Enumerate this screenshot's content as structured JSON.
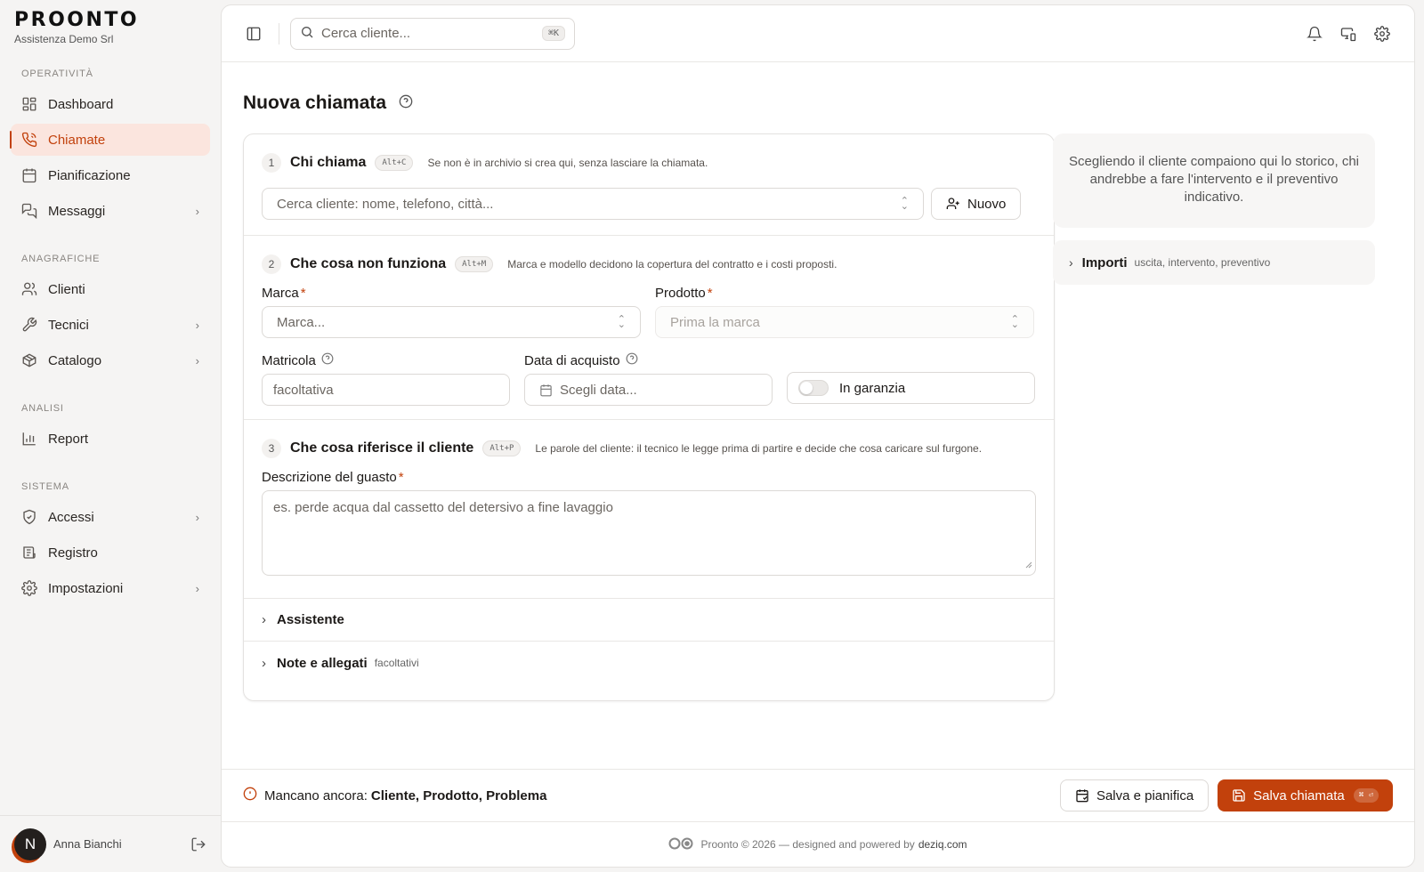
{
  "brand": {
    "logo": "PROONTO",
    "company": "Assistenza Demo Srl"
  },
  "sidebar": {
    "sections": [
      {
        "title": "OPERATIVITÀ",
        "items": [
          {
            "label": "Dashboard",
            "icon": "dashboard-icon"
          },
          {
            "label": "Chiamate",
            "icon": "phone-icon",
            "active": true
          },
          {
            "label": "Pianificazione",
            "icon": "calendar-icon"
          },
          {
            "label": "Messaggi",
            "icon": "messages-icon",
            "expandable": true
          }
        ]
      },
      {
        "title": "ANAGRAFICHE",
        "items": [
          {
            "label": "Clienti",
            "icon": "users-icon"
          },
          {
            "label": "Tecnici",
            "icon": "wrench-icon",
            "expandable": true
          },
          {
            "label": "Catalogo",
            "icon": "package-icon",
            "expandable": true
          }
        ]
      },
      {
        "title": "ANALISI",
        "items": [
          {
            "label": "Report",
            "icon": "bar-chart-icon"
          }
        ]
      },
      {
        "title": "SISTEMA",
        "items": [
          {
            "label": "Accessi",
            "icon": "shield-icon",
            "expandable": true
          },
          {
            "label": "Registro",
            "icon": "log-icon"
          },
          {
            "label": "Impostazioni",
            "icon": "gear-icon",
            "expandable": true
          }
        ]
      }
    ],
    "user": {
      "initial": "N",
      "name": "Anna Bianchi"
    }
  },
  "topbar": {
    "search_placeholder": "Cerca cliente...",
    "search_kbd": "⌘K"
  },
  "page": {
    "title": "Nuova chiamata"
  },
  "form": {
    "section1": {
      "step": "1",
      "title": "Chi chiama",
      "kbd": "Alt+C",
      "hint": "Se non è in archivio si crea qui, senza lasciare la chiamata.",
      "client_placeholder": "Cerca cliente: nome, telefono, città...",
      "new_button": "Nuovo"
    },
    "section2": {
      "step": "2",
      "title": "Che cosa non funziona",
      "kbd": "Alt+M",
      "hint": "Marca e modello decidono la copertura del contratto e i costi proposti.",
      "marca_label": "Marca",
      "marca_placeholder": "Marca...",
      "prodotto_label": "Prodotto",
      "prodotto_placeholder": "Prima la marca",
      "matricola_label": "Matricola",
      "matricola_placeholder": "facoltativa",
      "data_label": "Data di acquisto",
      "data_placeholder": "Scegli data...",
      "garanzia_label": "In garanzia",
      "required_mark": "*"
    },
    "section3": {
      "step": "3",
      "title": "Che cosa riferisce il cliente",
      "kbd": "Alt+P",
      "hint": "Le parole del cliente: il tecnico le legge prima di partire e decide che cosa caricare sul furgone.",
      "descrizione_label": "Descrizione del guasto",
      "descrizione_placeholder": "es. perde acqua dal cassetto del detersivo a fine lavaggio"
    },
    "assistente": {
      "title": "Assistente"
    },
    "note": {
      "title": "Note e allegati",
      "sub": "facoltativi"
    }
  },
  "side": {
    "info": "Scegliendo il cliente compaiono qui lo storico, chi andrebbe a fare l'intervento e il preventivo indicativo.",
    "importi_title": "Importi",
    "importi_sub": "uscita, intervento, preventivo"
  },
  "bottom": {
    "missing_prefix": "Mancano ancora:",
    "missing_items": "Cliente, Prodotto, Problema",
    "save_plan": "Salva e pianifica",
    "save_call": "Salva chiamata",
    "save_kbd": "⌘ ⏎"
  },
  "footer": {
    "text": "Proonto © 2026 — designed and powered by",
    "domain": "deziq.com"
  },
  "colors": {
    "accent": "#c2410c",
    "active_bg": "#fbe5de"
  }
}
